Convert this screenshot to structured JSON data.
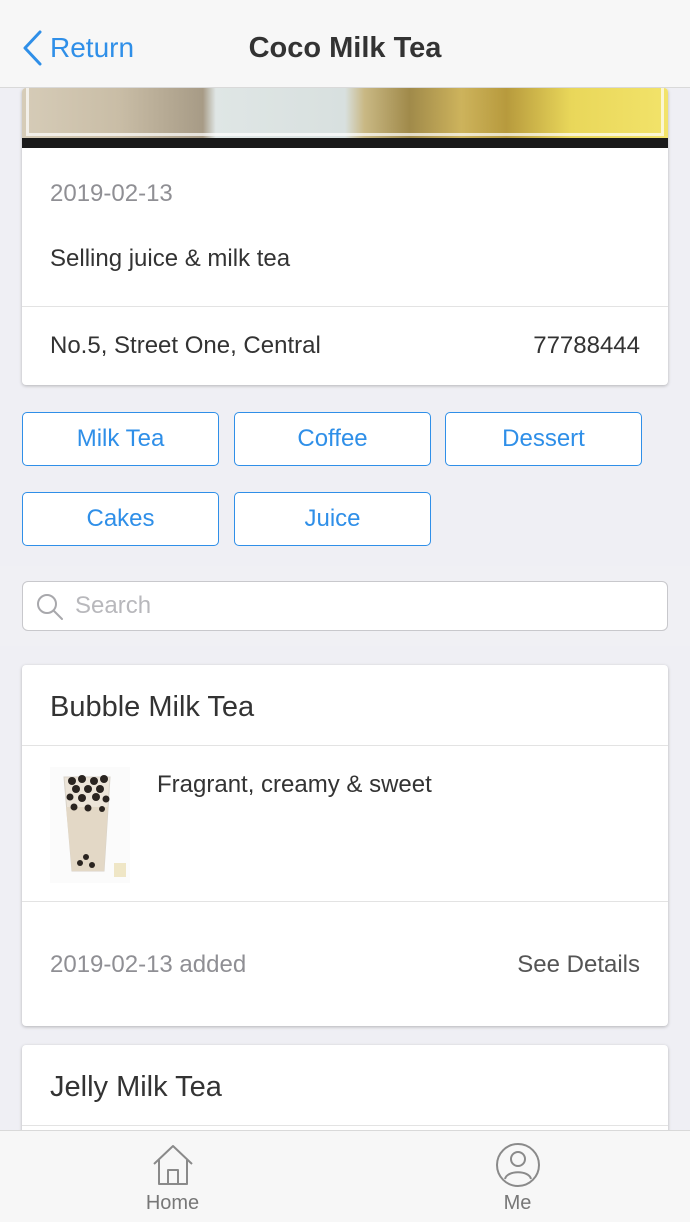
{
  "navbar": {
    "back_label": "Return",
    "title": "Coco Milk Tea"
  },
  "shop": {
    "date": "2019-02-13",
    "description": "Selling juice & milk tea",
    "address": "No.5, Street One, Central",
    "phone": "77788444"
  },
  "categories": [
    "Milk Tea",
    "Coffee",
    "Dessert",
    "Cakes",
    "Juice"
  ],
  "search": {
    "placeholder": "Search",
    "value": ""
  },
  "products": [
    {
      "name": "Bubble Milk Tea",
      "description": "Fragrant, creamy & sweet",
      "added": "2019-02-13 added",
      "details_label": "See Details"
    },
    {
      "name": "Jelly Milk Tea"
    }
  ],
  "tabbar": {
    "items": [
      {
        "label": "Home",
        "icon": "home-icon"
      },
      {
        "label": "Me",
        "icon": "person-icon"
      }
    ]
  },
  "colors": {
    "accent": "#2f8fe8",
    "background": "#efeff4",
    "muted_text": "#8f8f94"
  }
}
